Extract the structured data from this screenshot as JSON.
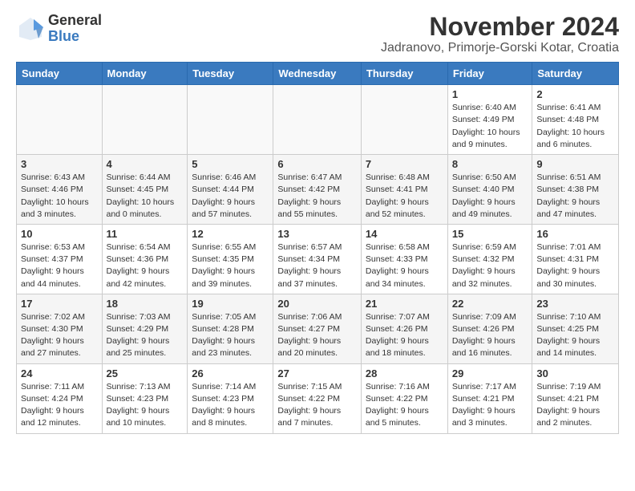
{
  "logo": {
    "general": "General",
    "blue": "Blue"
  },
  "title": "November 2024",
  "location": "Jadranovo, Primorje-Gorski Kotar, Croatia",
  "headers": [
    "Sunday",
    "Monday",
    "Tuesday",
    "Wednesday",
    "Thursday",
    "Friday",
    "Saturday"
  ],
  "weeks": [
    [
      {
        "day": "",
        "info": ""
      },
      {
        "day": "",
        "info": ""
      },
      {
        "day": "",
        "info": ""
      },
      {
        "day": "",
        "info": ""
      },
      {
        "day": "",
        "info": ""
      },
      {
        "day": "1",
        "info": "Sunrise: 6:40 AM\nSunset: 4:49 PM\nDaylight: 10 hours and 9 minutes."
      },
      {
        "day": "2",
        "info": "Sunrise: 6:41 AM\nSunset: 4:48 PM\nDaylight: 10 hours and 6 minutes."
      }
    ],
    [
      {
        "day": "3",
        "info": "Sunrise: 6:43 AM\nSunset: 4:46 PM\nDaylight: 10 hours and 3 minutes."
      },
      {
        "day": "4",
        "info": "Sunrise: 6:44 AM\nSunset: 4:45 PM\nDaylight: 10 hours and 0 minutes."
      },
      {
        "day": "5",
        "info": "Sunrise: 6:46 AM\nSunset: 4:44 PM\nDaylight: 9 hours and 57 minutes."
      },
      {
        "day": "6",
        "info": "Sunrise: 6:47 AM\nSunset: 4:42 PM\nDaylight: 9 hours and 55 minutes."
      },
      {
        "day": "7",
        "info": "Sunrise: 6:48 AM\nSunset: 4:41 PM\nDaylight: 9 hours and 52 minutes."
      },
      {
        "day": "8",
        "info": "Sunrise: 6:50 AM\nSunset: 4:40 PM\nDaylight: 9 hours and 49 minutes."
      },
      {
        "day": "9",
        "info": "Sunrise: 6:51 AM\nSunset: 4:38 PM\nDaylight: 9 hours and 47 minutes."
      }
    ],
    [
      {
        "day": "10",
        "info": "Sunrise: 6:53 AM\nSunset: 4:37 PM\nDaylight: 9 hours and 44 minutes."
      },
      {
        "day": "11",
        "info": "Sunrise: 6:54 AM\nSunset: 4:36 PM\nDaylight: 9 hours and 42 minutes."
      },
      {
        "day": "12",
        "info": "Sunrise: 6:55 AM\nSunset: 4:35 PM\nDaylight: 9 hours and 39 minutes."
      },
      {
        "day": "13",
        "info": "Sunrise: 6:57 AM\nSunset: 4:34 PM\nDaylight: 9 hours and 37 minutes."
      },
      {
        "day": "14",
        "info": "Sunrise: 6:58 AM\nSunset: 4:33 PM\nDaylight: 9 hours and 34 minutes."
      },
      {
        "day": "15",
        "info": "Sunrise: 6:59 AM\nSunset: 4:32 PM\nDaylight: 9 hours and 32 minutes."
      },
      {
        "day": "16",
        "info": "Sunrise: 7:01 AM\nSunset: 4:31 PM\nDaylight: 9 hours and 30 minutes."
      }
    ],
    [
      {
        "day": "17",
        "info": "Sunrise: 7:02 AM\nSunset: 4:30 PM\nDaylight: 9 hours and 27 minutes."
      },
      {
        "day": "18",
        "info": "Sunrise: 7:03 AM\nSunset: 4:29 PM\nDaylight: 9 hours and 25 minutes."
      },
      {
        "day": "19",
        "info": "Sunrise: 7:05 AM\nSunset: 4:28 PM\nDaylight: 9 hours and 23 minutes."
      },
      {
        "day": "20",
        "info": "Sunrise: 7:06 AM\nSunset: 4:27 PM\nDaylight: 9 hours and 20 minutes."
      },
      {
        "day": "21",
        "info": "Sunrise: 7:07 AM\nSunset: 4:26 PM\nDaylight: 9 hours and 18 minutes."
      },
      {
        "day": "22",
        "info": "Sunrise: 7:09 AM\nSunset: 4:26 PM\nDaylight: 9 hours and 16 minutes."
      },
      {
        "day": "23",
        "info": "Sunrise: 7:10 AM\nSunset: 4:25 PM\nDaylight: 9 hours and 14 minutes."
      }
    ],
    [
      {
        "day": "24",
        "info": "Sunrise: 7:11 AM\nSunset: 4:24 PM\nDaylight: 9 hours and 12 minutes."
      },
      {
        "day": "25",
        "info": "Sunrise: 7:13 AM\nSunset: 4:23 PM\nDaylight: 9 hours and 10 minutes."
      },
      {
        "day": "26",
        "info": "Sunrise: 7:14 AM\nSunset: 4:23 PM\nDaylight: 9 hours and 8 minutes."
      },
      {
        "day": "27",
        "info": "Sunrise: 7:15 AM\nSunset: 4:22 PM\nDaylight: 9 hours and 7 minutes."
      },
      {
        "day": "28",
        "info": "Sunrise: 7:16 AM\nSunset: 4:22 PM\nDaylight: 9 hours and 5 minutes."
      },
      {
        "day": "29",
        "info": "Sunrise: 7:17 AM\nSunset: 4:21 PM\nDaylight: 9 hours and 3 minutes."
      },
      {
        "day": "30",
        "info": "Sunrise: 7:19 AM\nSunset: 4:21 PM\nDaylight: 9 hours and 2 minutes."
      }
    ]
  ]
}
